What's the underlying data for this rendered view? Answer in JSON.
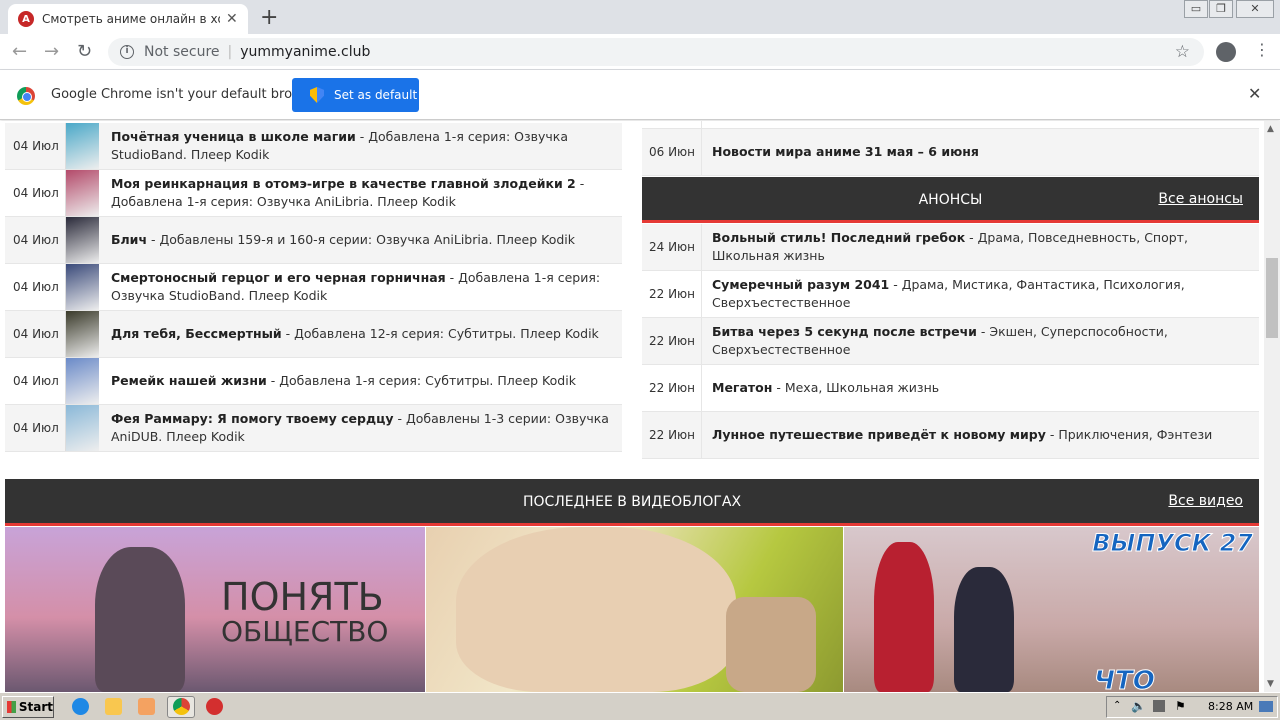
{
  "browser": {
    "tab_title": "Смотреть аниме онлайн в хорошем",
    "tab_close": "✕",
    "new_tab": "+",
    "not_secure": "Not secure",
    "url": "yummyanime.club",
    "window_controls": [
      "▭",
      "❐",
      "✕"
    ]
  },
  "infobar": {
    "message": "Google Chrome isn't your default browser",
    "button": "Set as default",
    "close": "✕"
  },
  "updates": [
    {
      "date": "04 Июл",
      "title": "Почётная ученица в школе магии",
      "desc": " - Добавлена 1-я серия: Озвучка StudioBand. Плеер Kodik",
      "color": "#4aa8c8"
    },
    {
      "date": "04 Июл",
      "title": "Моя реинкарнация в отомэ-игре в качестве главной злодейки 2",
      "desc": " - Добавлена 1-я серия: Озвучка AniLibria. Плеер Kodik",
      "color": "#b34a6a"
    },
    {
      "date": "04 Июл",
      "title": "Блич",
      "desc": " - Добавлены 159-я и 160-я серии: Озвучка AniLibria. Плеер Kodik",
      "color": "#2a2a3a"
    },
    {
      "date": "04 Июл",
      "title": "Смертоносный герцог и его черная горничная",
      "desc": " - Добавлена 1-я серия: Озвучка StudioBand. Плеер Kodik",
      "color": "#3a4a7a"
    },
    {
      "date": "04 Июл",
      "title": "Для тебя, Бессмертный",
      "desc": " - Добавлена 12-я серия: Субтитры. Плеер Kodik",
      "color": "#3a3a2a"
    },
    {
      "date": "04 Июл",
      "title": "Ремейк нашей жизни",
      "desc": " - Добавлена 1-я серия: Субтитры. Плеер Kodik",
      "color": "#6a8ac8"
    },
    {
      "date": "04 Июл",
      "title": "Фея Раммару: Я помогу твоему сердцу",
      "desc": " - Добавлены 1-3 серии: Озвучка AniDUB. Плеер Kodik",
      "color": "#8ab8d8"
    }
  ],
  "news": {
    "date": "06 Июн",
    "title": "Новости мира аниме 31 мая – 6 июня"
  },
  "announcements": {
    "header": "АНОНСЫ",
    "all_link": "Все анонсы",
    "items": [
      {
        "date": "24 Июн",
        "title": "Вольный стиль! Последний гребок",
        "desc": " - Драма, Повседневность, Спорт, Школьная жизнь"
      },
      {
        "date": "22 Июн",
        "title": "Сумеречный разум 2041",
        "desc": " - Драма, Мистика, Фантастика, Психология, Сверхъестественное"
      },
      {
        "date": "22 Июн",
        "title": "Битва через 5 секунд после встречи",
        "desc": " - Экшен, Суперспособности, Сверхъестественное"
      },
      {
        "date": "22 Июн",
        "title": "Мегатон",
        "desc": " - Меха, Школьная жизнь"
      },
      {
        "date": "22 Июн",
        "title": "Лунное путешествие приведёт к новому миру",
        "desc": " - Приключения, Фэнтези"
      }
    ]
  },
  "videoblogs": {
    "header": "ПОСЛЕДНЕЕ В ВИДЕОБЛОГАХ",
    "all_link": "Все видео",
    "v1_line1": "ПОНЯТЬ",
    "v1_line2": "ОБЩЕСТВО",
    "v3_issue": "ВЫПУСК 27",
    "v3_bottom": "ЧТО"
  },
  "taskbar": {
    "start": "Start",
    "time": "8:28 AM"
  }
}
